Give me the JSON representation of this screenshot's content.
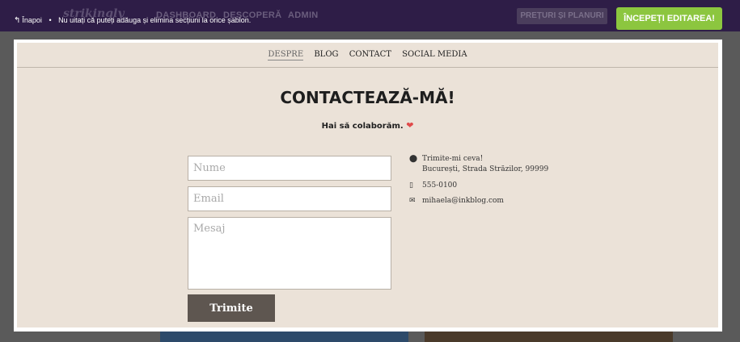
{
  "app": {
    "brand": "strikingly",
    "nav": [
      "DASHBOARD",
      "DESCOPERĂ",
      "ADMIN"
    ],
    "pricing_label": "PREȚURI ȘI PLANURI",
    "start_label": "ÎNCEPEȚI EDITAREA!"
  },
  "backbar": {
    "back_label": "Înapoi",
    "tip": "Nu uitați că puteți adăuga și elimina secțiuni la orice șablon."
  },
  "site_nav": [
    "DESPRE",
    "BLOG",
    "CONTACT",
    "SOCIAL MEDIA"
  ],
  "contact": {
    "title": "CONTACTEAZĂ-MĂ!",
    "subtitle": "Hai să colaborăm.",
    "form": {
      "name_placeholder": "Nume",
      "email_placeholder": "Email",
      "message_placeholder": "Mesaj",
      "submit_label": "Trimite"
    },
    "info": {
      "address_line1": "Trimite-mi ceva!",
      "address_line2": "București, Strada Străzilor, 99999",
      "phone": "555-0100",
      "email": "mihaela@inkblog.com"
    }
  },
  "colors": {
    "topbar": "#2e1d47",
    "accent_green": "#8cc63f",
    "section_bg": "#ebe2d8",
    "button_bg": "#5e5650",
    "heart": "#e04a4a"
  }
}
